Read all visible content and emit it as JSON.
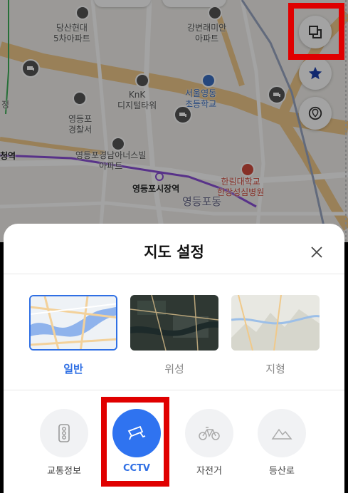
{
  "map": {
    "labels": {
      "dangsan_apt": "당산현대\n5차아파트",
      "gangbyeon_apt": "강변래미안\n아파트",
      "knk": "KnK\n디지털타워",
      "community": "서울영동\n초등학교",
      "police": "영등포\n경찰서",
      "station_left": "청역",
      "prefix_left": "정",
      "gyeongnam_apt": "영등포경남아너스빌\n아파트",
      "market_station": "영등포시장역",
      "hospital": "한림대학교\n한강성심병원",
      "district": "영등포동"
    },
    "side_buttons": [
      "layers-icon",
      "star-icon",
      "location-pin-icon"
    ]
  },
  "sheet": {
    "title": "지도 설정",
    "map_types": [
      {
        "label": "일반",
        "selected": true
      },
      {
        "label": "위성",
        "selected": false
      },
      {
        "label": "지형",
        "selected": false
      }
    ],
    "layers": [
      {
        "label": "교통정보",
        "icon": "traffic-light-icon",
        "on": false
      },
      {
        "label": "CCTV",
        "icon": "cctv-icon",
        "on": true
      },
      {
        "label": "자전거",
        "icon": "bicycle-icon",
        "on": false
      },
      {
        "label": "등산로",
        "icon": "mountain-icon",
        "on": false
      }
    ]
  },
  "colors": {
    "accent": "#2f73f0",
    "highlight": "#e00000"
  }
}
